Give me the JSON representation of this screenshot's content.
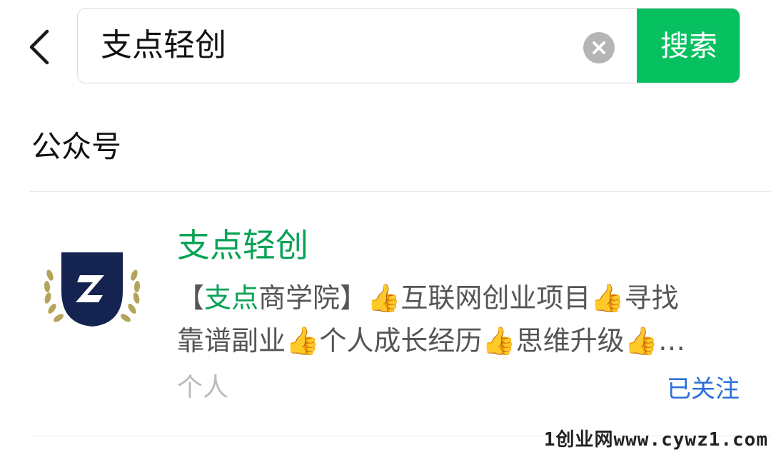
{
  "search": {
    "query": "支点轻创",
    "button_label": "搜索"
  },
  "section": {
    "title": "公众号"
  },
  "result": {
    "name": "支点轻创",
    "description_line1": {
      "bracket_open": "【",
      "highlight": "支点",
      "after_highlight": "商学院】👍互联网创业项目👍寻找"
    },
    "description_line2": "靠谱副业👍个人成长经历👍思维升级👍…",
    "account_type": "个人",
    "follow_status": "已关注"
  },
  "watermark": {
    "text": "1创业网www.cywz1.com"
  },
  "colors": {
    "accent": "#07c160",
    "name_green": "#07a354",
    "link_blue": "#2b6fd8",
    "avatar_navy": "#14234f"
  },
  "icons": {
    "back": "chevron-left-icon",
    "clear": "clear-circle-icon",
    "avatar": "fulcrum-badge-logo"
  }
}
